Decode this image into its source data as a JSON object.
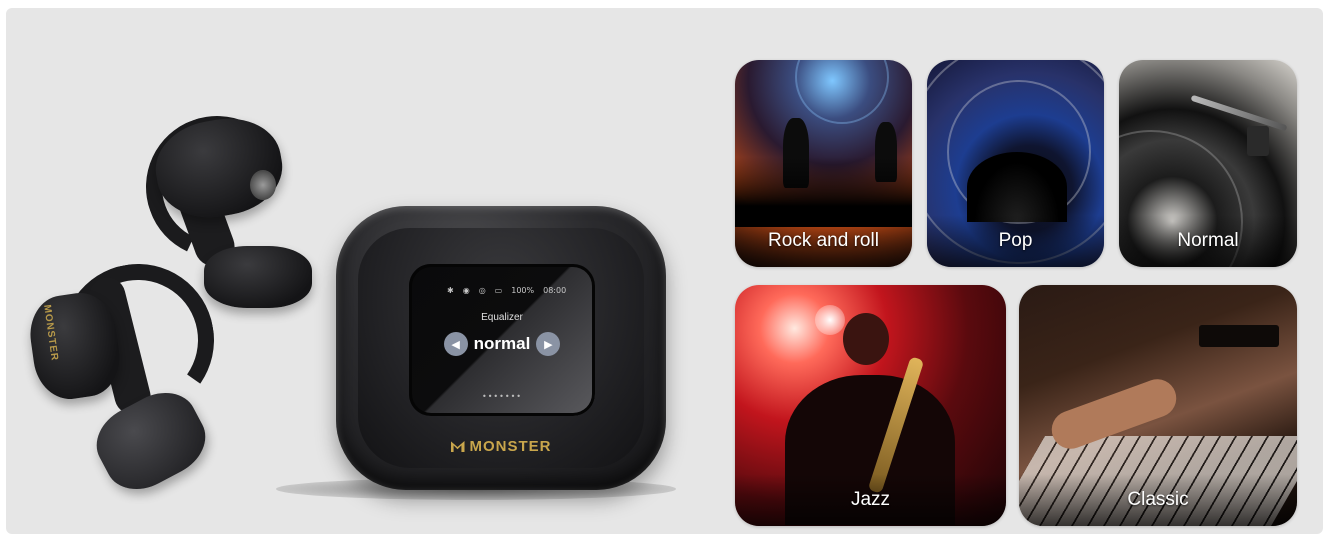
{
  "device": {
    "screen_title": "Equalizer",
    "screen_value": "normal",
    "battery": "100%",
    "time": "08:00",
    "brand": "MONSTER",
    "earbud_brand": "MONSTER",
    "page_dots": "•••••••"
  },
  "eq_modes": [
    {
      "label": "Rock and roll"
    },
    {
      "label": "Pop"
    },
    {
      "label": "Normal"
    },
    {
      "label": "Jazz"
    },
    {
      "label": "Classic"
    }
  ],
  "colors": {
    "background": "#e6e6e6",
    "brand_gold": "#c9a64c",
    "arrow_button": "#8a93a4"
  }
}
